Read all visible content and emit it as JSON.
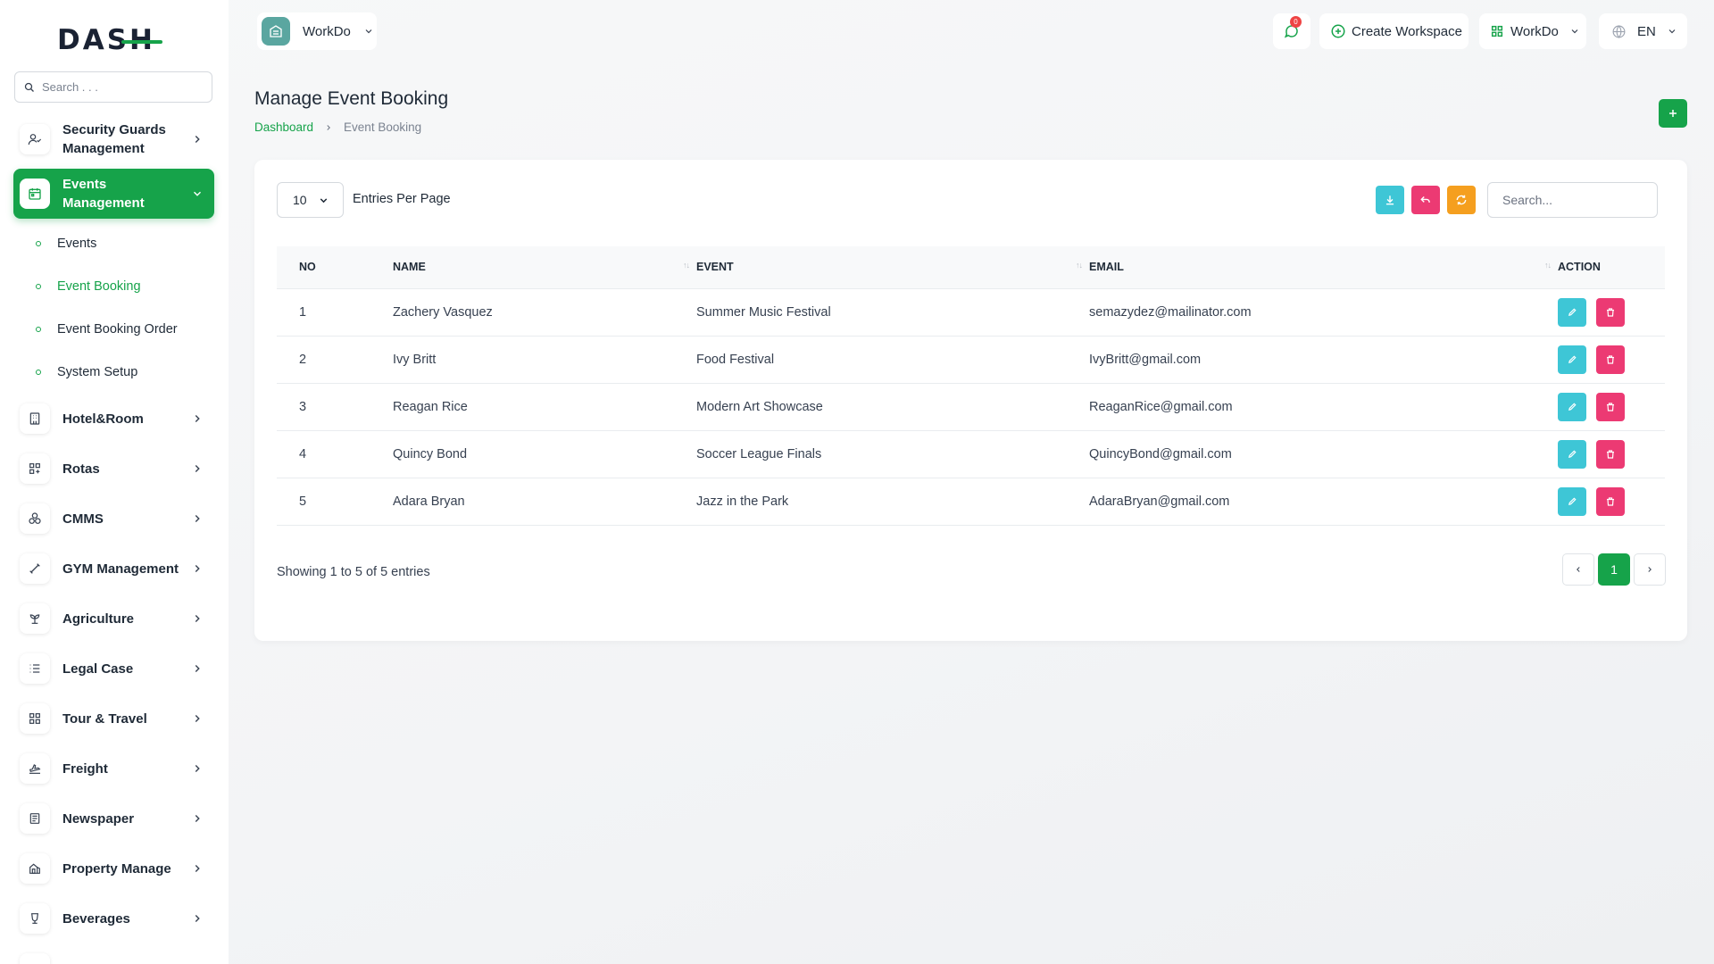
{
  "brand": {
    "logo_text": "DASH"
  },
  "sidebar": {
    "search_placeholder": "Search . . .",
    "items": [
      {
        "label": "Security Guards Management",
        "icon": "guard-icon"
      },
      {
        "label": "Events Management",
        "icon": "calendar-icon",
        "active": true
      },
      {
        "label": "Hotel&Room",
        "icon": "building-icon"
      },
      {
        "label": "Rotas",
        "icon": "grid-icon"
      },
      {
        "label": "CMMS",
        "icon": "components-icon"
      },
      {
        "label": "GYM Management",
        "icon": "dumbbell-icon"
      },
      {
        "label": "Agriculture",
        "icon": "plant-icon"
      },
      {
        "label": "Legal Case",
        "icon": "list-icon"
      },
      {
        "label": "Tour & Travel",
        "icon": "apps-icon"
      },
      {
        "label": "Freight",
        "icon": "plane-icon"
      },
      {
        "label": "Newspaper",
        "icon": "newspaper-icon"
      },
      {
        "label": "Property Manage",
        "icon": "home-icon"
      },
      {
        "label": "Beverages",
        "icon": "cup-icon"
      }
    ],
    "subitems": [
      {
        "label": "Events"
      },
      {
        "label": "Event Booking",
        "current": true
      },
      {
        "label": "Event Booking Order"
      },
      {
        "label": "System Setup"
      }
    ]
  },
  "header": {
    "workspace_name": "WorkDo",
    "notification_count": "0",
    "create_workspace": "Create Workspace",
    "workspace_menu": "WorkDo",
    "language": "EN"
  },
  "page": {
    "title": "Manage Event Booking",
    "breadcrumb": {
      "home": "Dashboard",
      "current": "Event Booking"
    }
  },
  "table": {
    "per_page_value": "10",
    "per_page_label": "Entries Per Page",
    "search_placeholder": "Search...",
    "columns": [
      "NO",
      "NAME",
      "EVENT",
      "EMAIL",
      "ACTION"
    ],
    "sort_glyph": "↑↓",
    "rows": [
      {
        "no": "1",
        "name": "Zachery Vasquez",
        "event": "Summer Music Festival",
        "email": "semazydez@mailinator.com"
      },
      {
        "no": "2",
        "name": "Ivy Britt",
        "event": "Food Festival",
        "email": "IvyBritt@gmail.com"
      },
      {
        "no": "3",
        "name": "Reagan Rice",
        "event": "Modern Art Showcase",
        "email": "ReaganRice@gmail.com"
      },
      {
        "no": "4",
        "name": "Quincy Bond",
        "event": "Soccer League Finals",
        "email": "QuincyBond@gmail.com"
      },
      {
        "no": "5",
        "name": "Adara Bryan",
        "event": "Jazz in the Park",
        "email": "AdaraBryan@gmail.com"
      }
    ],
    "showing_text": "Showing 1 to 5 of 5 entries",
    "current_page": "1"
  },
  "colors": {
    "accent": "#16a34a",
    "edit": "#3ec6d6",
    "delete": "#ec3a73",
    "export": "#3ec6d6",
    "reset": "#ec3a73",
    "refresh": "#f59f1f"
  }
}
